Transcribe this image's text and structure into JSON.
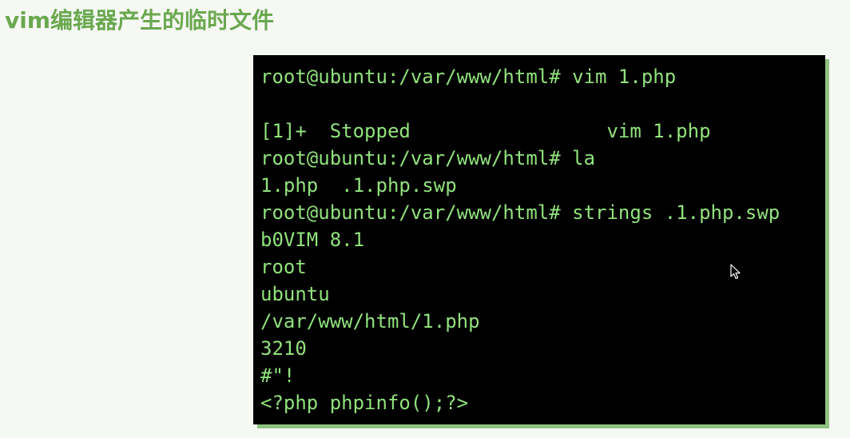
{
  "slide": {
    "title": "vim编辑器产生的临时文件"
  },
  "terminal": {
    "lines": [
      "root@ubuntu:/var/www/html# vim 1.php",
      "",
      "[1]+  Stopped                 vim 1.php",
      "root@ubuntu:/var/www/html# la",
      "1.php  .1.php.swp",
      "root@ubuntu:/var/www/html# strings .1.php.swp",
      "b0VIM 8.1",
      "root",
      "ubuntu",
      "/var/www/html/1.php",
      "3210",
      "#\"!",
      "<?php phpinfo();?>"
    ]
  },
  "colors": {
    "title": "#6aa84f",
    "terminal_background": "#000000",
    "terminal_text": "#91e27c",
    "page_background": "#f6f8f4"
  },
  "icons": {
    "mouse_pointer": "mouse-pointer-icon"
  }
}
